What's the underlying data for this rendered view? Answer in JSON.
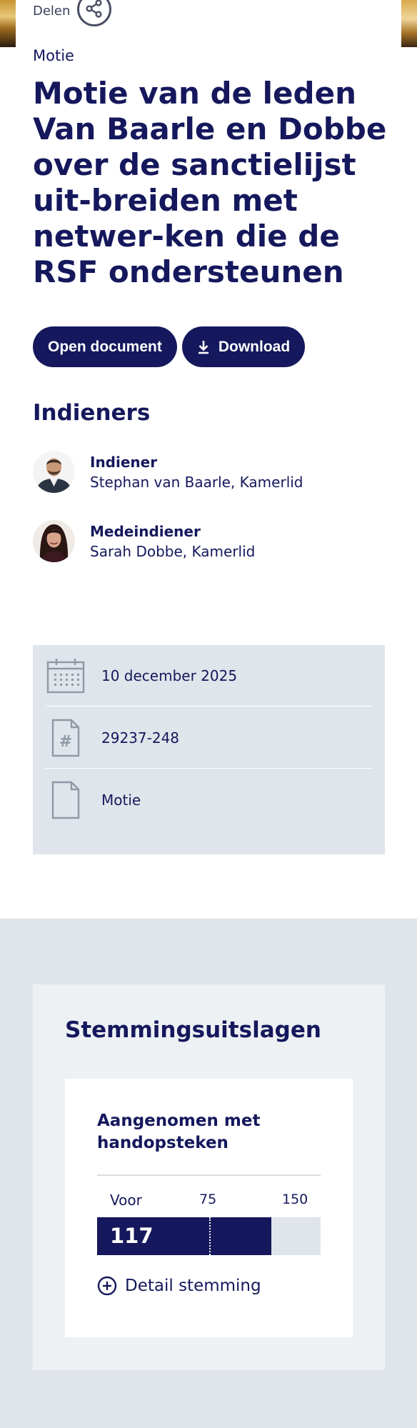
{
  "share": {
    "label": "Delen",
    "icon": "share-icon"
  },
  "document": {
    "type": "Motie",
    "title": "Motie van de leden Van Baarle en Dobbe over de sanctielijst uit-breiden met netwer-ken die de RSF ondersteunen"
  },
  "buttons": {
    "open_label": "Open document",
    "download_label": "Download"
  },
  "submitters": {
    "heading": "Indieners",
    "items": [
      {
        "role": "Indiener",
        "name": "Stephan van Baarle, Kamerlid"
      },
      {
        "role": "Medeindiener",
        "name": "Sarah Dobbe, Kamerlid"
      }
    ]
  },
  "meta": {
    "date": "10 december 2025",
    "number": "29237-248",
    "kind": "Motie"
  },
  "votes": {
    "heading": "Stemmingsuitslagen",
    "result": "Aangenomen met handopsteken",
    "scale_label": "Voor",
    "scale_mid": "75",
    "scale_max": "150",
    "value": "117",
    "value_num": 117,
    "mid_num": 75,
    "max_num": 150,
    "detail_label": "Detail stemming"
  },
  "colors": {
    "brand": "#15185c",
    "panel": "#dfe5ea"
  }
}
